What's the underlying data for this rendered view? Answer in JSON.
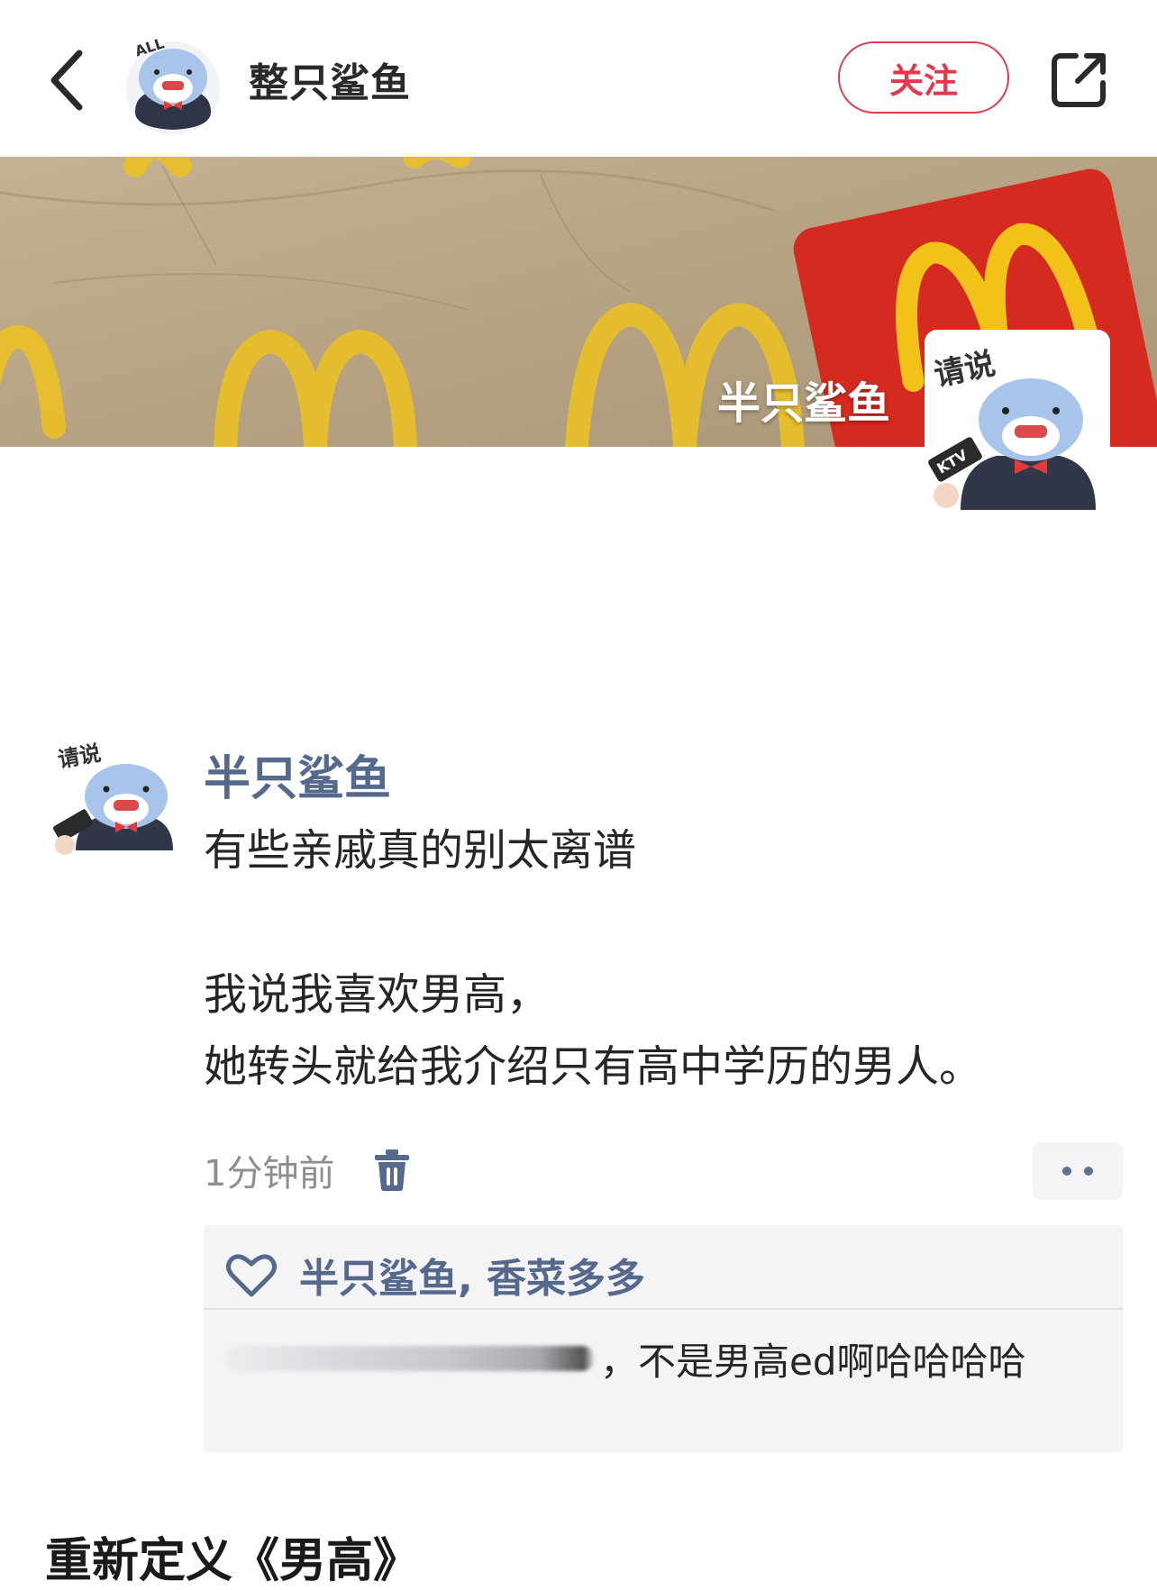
{
  "nav": {
    "title": "整只鲨鱼",
    "follow_label": "关注",
    "avatar_text": "ALL"
  },
  "banner": {
    "watermark": "半只鲨鱼",
    "sticker_text": "请说",
    "mic_text": "KTV"
  },
  "post": {
    "author": "半只鲨鱼",
    "avatar_text": "请说",
    "lines": [
      "有些亲戚真的别太离谱",
      "",
      "我说我喜欢男高，",
      "她转头就给我介绍只有高中学历的男人。"
    ],
    "time": "1分钟前",
    "likes": "半只鲨鱼, 香菜多多",
    "reply_suffix": "，不是男高ed啊哈哈哈哈"
  },
  "section_title": "重新定义《男高》",
  "colors": {
    "accent_red": "#e5384d",
    "link_blue": "#55698d",
    "mcd_red": "#d52a1f",
    "mcd_yellow": "#f2c21b"
  },
  "icons": [
    "back-arrow-icon",
    "share-icon",
    "trash-icon",
    "more-dots-icon",
    "heart-icon"
  ]
}
